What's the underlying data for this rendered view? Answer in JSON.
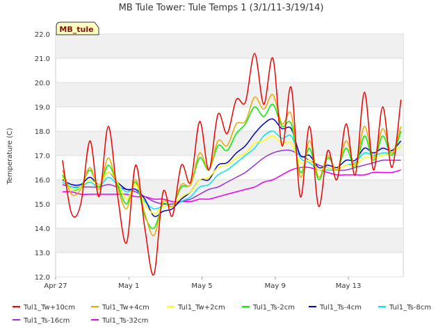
{
  "chart_data": {
    "type": "line",
    "title": "MB Tule Tower: Tule Temps 1 (3/1/11-3/19/14)",
    "tag": "MB_tule",
    "xlabel": "",
    "ylabel": "Temperature (C)",
    "ylim": [
      12.0,
      22.0
    ],
    "xlim": [
      "2014-04-27",
      "2014-05-16"
    ],
    "yticks": [
      "12.0",
      "13.0",
      "14.0",
      "15.0",
      "16.0",
      "17.0",
      "18.0",
      "19.0",
      "20.0",
      "21.0",
      "22.0"
    ],
    "xticks": [
      {
        "date": "2014-04-27",
        "label": "Apr 27"
      },
      {
        "date": "2014-05-01",
        "label": "May 1"
      },
      {
        "date": "2014-05-05",
        "label": "May 5"
      },
      {
        "date": "2014-05-09",
        "label": "May 9"
      },
      {
        "date": "2014-05-13",
        "label": "May 13"
      }
    ],
    "grid": true,
    "legend_position": "bottom",
    "x": [
      "2014-04-27 09:00",
      "2014-04-27 21:00",
      "2014-04-28 09:00",
      "2014-04-28 21:00",
      "2014-04-29 09:00",
      "2014-04-29 21:00",
      "2014-04-30 09:00",
      "2014-04-30 21:00",
      "2014-05-01 09:00",
      "2014-05-01 21:00",
      "2014-05-02 09:00",
      "2014-05-02 21:00",
      "2014-05-03 09:00",
      "2014-05-03 21:00",
      "2014-05-04 09:00",
      "2014-05-04 21:00",
      "2014-05-05 09:00",
      "2014-05-05 21:00",
      "2014-05-06 09:00",
      "2014-05-06 21:00",
      "2014-05-07 09:00",
      "2014-05-07 21:00",
      "2014-05-08 09:00",
      "2014-05-08 21:00",
      "2014-05-09 09:00",
      "2014-05-09 21:00",
      "2014-05-10 09:00",
      "2014-05-10 21:00",
      "2014-05-11 09:00",
      "2014-05-11 21:00",
      "2014-05-12 09:00",
      "2014-05-12 21:00",
      "2014-05-13 09:00",
      "2014-05-13 21:00",
      "2014-05-14 09:00",
      "2014-05-14 21:00",
      "2014-05-15 09:00",
      "2014-05-15 21:00"
    ],
    "series": [
      {
        "name": "Tul1_Tw+10cm",
        "color": "#ee0000",
        "values": [
          16.8,
          14.6,
          15.0,
          17.6,
          15.3,
          18.2,
          15.4,
          13.4,
          16.6,
          14.0,
          12.1,
          15.5,
          14.5,
          16.6,
          15.9,
          18.4,
          16.4,
          18.7,
          17.9,
          19.3,
          19.2,
          21.2,
          19.1,
          21.0,
          17.4,
          19.8,
          15.3,
          18.2,
          14.9,
          17.2,
          16.0,
          18.3,
          16.2,
          19.6,
          16.4,
          19.0,
          16.5,
          19.3
        ]
      },
      {
        "name": "Tul1_Tw+4cm",
        "color": "#e8a800",
        "values": [
          16.4,
          15.4,
          15.6,
          16.5,
          15.6,
          16.9,
          15.7,
          14.8,
          16.0,
          14.6,
          13.7,
          15.1,
          14.9,
          15.8,
          15.8,
          17.1,
          16.4,
          17.6,
          17.4,
          18.3,
          18.4,
          19.4,
          18.9,
          19.5,
          18.3,
          18.7,
          16.1,
          17.6,
          16.1,
          17.0,
          16.4,
          17.6,
          16.6,
          18.2,
          16.9,
          18.1,
          17.1,
          18.2
        ]
      },
      {
        "name": "Tul1_Tw+2cm",
        "color": "#ffff00",
        "values": [
          16.1,
          15.6,
          15.7,
          16.0,
          15.8,
          16.3,
          15.9,
          15.2,
          15.8,
          15.0,
          14.6,
          14.9,
          14.9,
          15.3,
          15.5,
          16.0,
          16.1,
          16.5,
          16.6,
          16.9,
          17.1,
          17.5,
          17.6,
          17.8,
          17.5,
          17.5,
          16.7,
          16.8,
          16.4,
          16.5,
          16.4,
          16.6,
          16.6,
          16.9,
          16.9,
          17.0,
          17.1,
          17.4
        ]
      },
      {
        "name": "Tul1_Ts-2cm",
        "color": "#00ee00",
        "values": [
          16.2,
          15.6,
          15.7,
          16.4,
          15.7,
          16.6,
          15.8,
          15.0,
          15.9,
          14.5,
          14.0,
          15.0,
          14.9,
          15.7,
          15.8,
          16.9,
          16.4,
          17.4,
          17.2,
          17.9,
          18.3,
          19.0,
          18.6,
          19.1,
          18.2,
          18.3,
          16.3,
          17.3,
          16.0,
          16.9,
          16.4,
          17.3,
          16.5,
          17.8,
          16.8,
          17.8,
          17.0,
          18.0
        ]
      },
      {
        "name": "Tul1_Ts-4cm",
        "color": "#0000cc",
        "values": [
          16.0,
          15.8,
          15.8,
          16.1,
          15.8,
          16.3,
          15.9,
          15.6,
          15.6,
          15.2,
          14.5,
          14.7,
          14.8,
          15.2,
          15.5,
          16.0,
          16.0,
          16.6,
          16.7,
          17.1,
          17.4,
          17.9,
          18.3,
          18.5,
          18.1,
          18.1,
          17.0,
          17.0,
          16.5,
          16.6,
          16.5,
          16.8,
          16.8,
          17.3,
          17.1,
          17.3,
          17.2,
          17.6
        ]
      },
      {
        "name": "Tul1_Ts-8cm",
        "color": "#00e5ee",
        "values": [
          15.9,
          15.7,
          15.7,
          15.9,
          15.7,
          16.1,
          15.8,
          15.5,
          15.6,
          15.1,
          14.8,
          14.9,
          14.9,
          15.1,
          15.3,
          15.7,
          15.8,
          16.2,
          16.4,
          16.7,
          17.0,
          17.3,
          17.8,
          18.0,
          17.7,
          17.8,
          16.9,
          16.7,
          16.4,
          16.4,
          16.4,
          16.6,
          16.7,
          17.1,
          17.0,
          17.1,
          17.1,
          17.4
        ]
      },
      {
        "name": "Tul1_Ts-16cm",
        "color": "#9933cc",
        "values": [
          15.8,
          15.7,
          15.7,
          15.7,
          15.7,
          15.8,
          15.7,
          15.6,
          15.5,
          15.3,
          15.1,
          15.0,
          15.0,
          15.1,
          15.2,
          15.4,
          15.6,
          15.7,
          15.9,
          16.1,
          16.3,
          16.6,
          16.9,
          17.1,
          17.2,
          17.2,
          17.0,
          16.8,
          16.6,
          16.5,
          16.4,
          16.4,
          16.5,
          16.6,
          16.7,
          16.8,
          16.8,
          16.8
        ]
      },
      {
        "name": "Tul1_Ts-32cm",
        "color": "#ee00ee",
        "values": [
          15.5,
          15.5,
          15.4,
          15.4,
          15.4,
          15.4,
          15.4,
          15.4,
          15.3,
          15.3,
          15.2,
          15.2,
          15.1,
          15.1,
          15.1,
          15.2,
          15.2,
          15.3,
          15.4,
          15.5,
          15.6,
          15.7,
          15.9,
          16.0,
          16.2,
          16.4,
          16.5,
          16.5,
          16.4,
          16.3,
          16.2,
          16.2,
          16.2,
          16.2,
          16.3,
          16.3,
          16.3,
          16.4
        ]
      }
    ]
  }
}
